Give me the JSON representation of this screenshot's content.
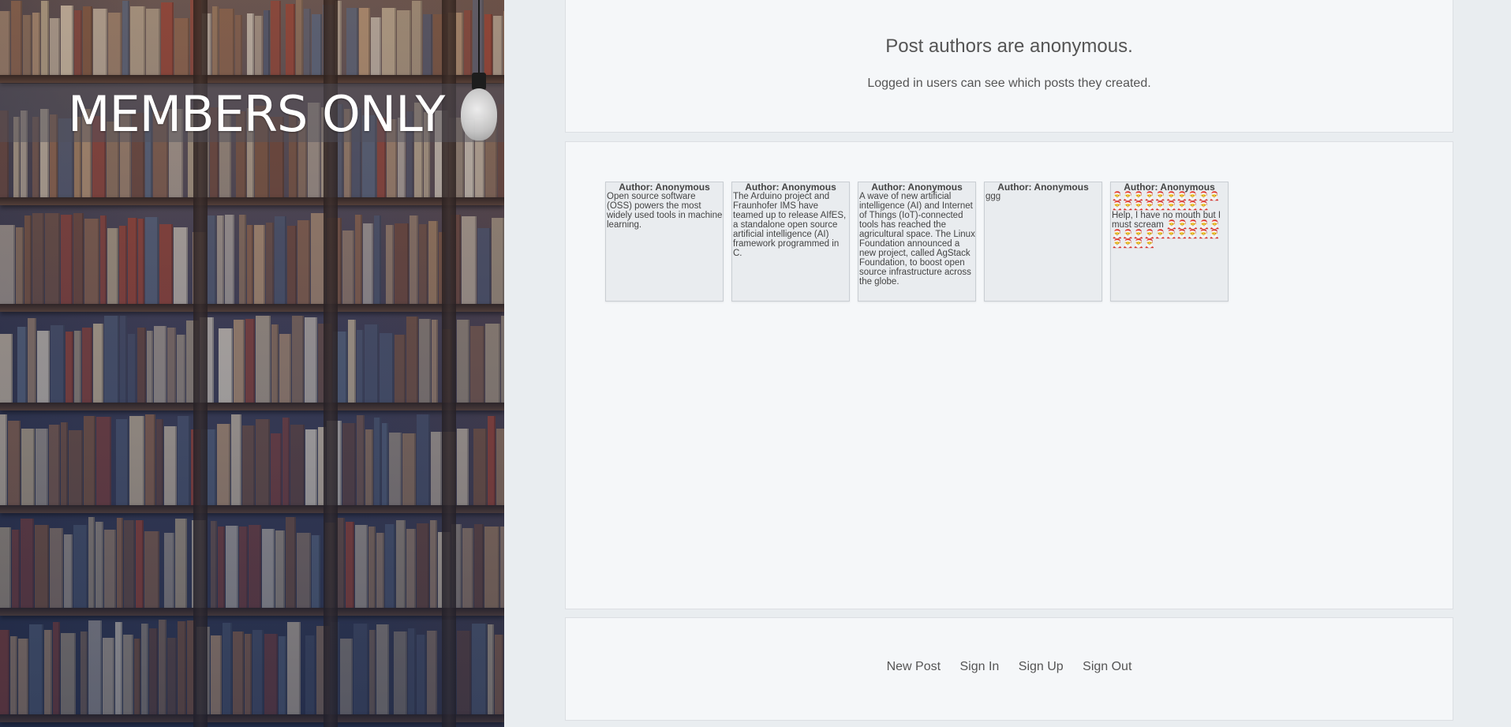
{
  "hero": {
    "title": "MEMBERS ONLY",
    "background": "bookshelf-photo",
    "decor": "lightbulb-icon"
  },
  "intro": {
    "headline": "Post authors are anonymous.",
    "subline": "Logged in users can see which posts they created."
  },
  "posts": [
    {
      "author": "Author: Anonymous",
      "body": "Open source software (OSS) powers the most widely used tools in machine learning."
    },
    {
      "author": "Author: Anonymous",
      "body": "The Arduino project and Fraunhofer IMS have teamed up to release AIfES, a standalone open source artificial intelligence (AI) framework programmed in C."
    },
    {
      "author": "Author: Anonymous",
      "body": "A wave of new artificial intelligence (AI) and Internet of Things (IoT)-connected tools has reached the agricultural space. The Linux Foundation announced a new project, called AgStack Foundation, to boost open source infrastructure across the globe."
    },
    {
      "author": "Author: Anonymous",
      "body": "ggg"
    },
    {
      "author": "Author: Anonymous",
      "body_before": "🎅🎅🎅🎅🎅🎅🎅🎅🎅🎅🎅🎅🎅🎅🎅🎅🎅🎅🎅",
      "body_text": "Help, I have no mouth but I must scream",
      "body_after": "🎅🎅🎅🎅🎅🎅🎅🎅🎅🎅🎅🎅🎅🎅🎅🎅🎅🎅🎅"
    }
  ],
  "footer_nav": {
    "new_post": "New Post",
    "sign_in": "Sign In",
    "sign_up": "Sign Up",
    "sign_out": "Sign Out"
  },
  "colors": {
    "page_bg": "#e9edf0",
    "panel_bg": "#f5f7f9",
    "card_bg": "#e9ecef",
    "text": "#555555",
    "hero_title": "#ffffff"
  }
}
